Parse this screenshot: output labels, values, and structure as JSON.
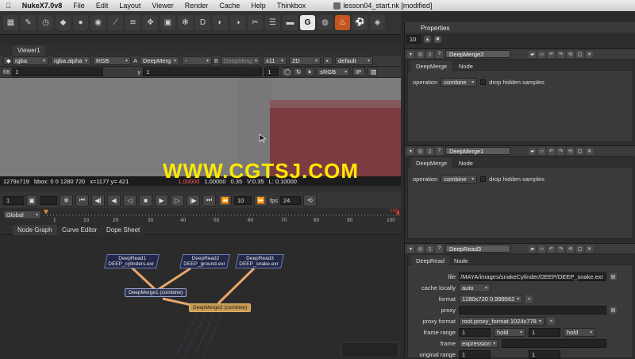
{
  "menubar": {
    "app": "NukeX7.0v8",
    "items": [
      "File",
      "Edit",
      "Layout",
      "Viewer",
      "Render",
      "Cache",
      "Help",
      "Thinkbox"
    ],
    "document": "lesson04_start.nk [modified]"
  },
  "toolbar": {
    "icons": [
      "G"
    ]
  },
  "properties": {
    "title": "Properties",
    "max_panels": "10"
  },
  "viewer": {
    "tab": "Viewer1",
    "channels": "rgba",
    "alpha": "rgba.alpha",
    "rgb": "RGB",
    "a_label": "A",
    "a_node": "DeepMerg",
    "wipe": "-",
    "b_label": "B",
    "b_node": "DeepMerg",
    "zoom": "x11",
    "view": "2D",
    "lut_default": "default",
    "fstop": "f/8",
    "gain": "1",
    "y_label": "y",
    "gamma": "1",
    "proxy_scale": "1",
    "colorspace": "sRGB",
    "ip": "IP"
  },
  "info": {
    "size": "1279x719",
    "bbox": "bbox: 0 0 1280 720",
    "coords": "x=1177 y= 421",
    "v1": "1.00000",
    "v2": "1.00000",
    "v3": "0.35",
    "v4": "V:0.35",
    "v5": "L: 0.10000"
  },
  "watermark": "WWW.CGTSJ.COM",
  "transport": {
    "frame": "1",
    "step": "10",
    "fps_label": "fps",
    "fps": "24"
  },
  "timeline": {
    "mode": "Global",
    "start": "1",
    "ticks": [
      "10",
      "20",
      "30",
      "40",
      "50",
      "60",
      "70",
      "80",
      "90",
      "100"
    ],
    "end_mark": "100",
    "current_top": "100"
  },
  "nodegraph": {
    "tabs": [
      "Node Graph",
      "Curve Editor",
      "Dope Sheet"
    ],
    "reads": [
      {
        "name": "DeepRead1",
        "file": "DEEP_cylinders.exr"
      },
      {
        "name": "DeepRead2",
        "file": "DEEP_ground.exr"
      },
      {
        "name": "DeepRead3",
        "file": "DEEP_snake.exr"
      }
    ],
    "merge1": "DeepMerge1 (combine)",
    "merge2": "DeepMerge2 (combine)"
  },
  "panels": {
    "p1": {
      "name": "DeepMerge2",
      "tabs": [
        "DeepMerge",
        "Node"
      ],
      "operation_label": "operation",
      "operation": "combine",
      "drop_label": "drop hidden samples"
    },
    "p2": {
      "name": "DeepMerge1",
      "tabs": [
        "DeepMerge",
        "Node"
      ],
      "operation_label": "operation",
      "operation": "combine",
      "drop_label": "drop hidden samples"
    },
    "p3": {
      "name": "DeepRead3",
      "tabs": [
        "DeepRead",
        "Node"
      ],
      "file_label": "file",
      "file": "R:/MAYA/images/snakeCylinder/DEEP/DEEP_snake.exr",
      "cache_label": "cache locally",
      "cache": "auto",
      "format_label": "format",
      "format": "1280x720 0.999562",
      "proxy_label": "proxy",
      "proxy_format_label": "proxy format",
      "proxy_format": "root.proxy_format 1024x778",
      "frame_range_label": "frame range",
      "fr_start": "1",
      "fr_start_mode": "hold",
      "fr_end": "1",
      "fr_end_mode": "hold",
      "frame_label": "frame",
      "frame_mode": "expression",
      "orig_label": "original range",
      "orig_start": "1",
      "orig_end": "1"
    }
  }
}
